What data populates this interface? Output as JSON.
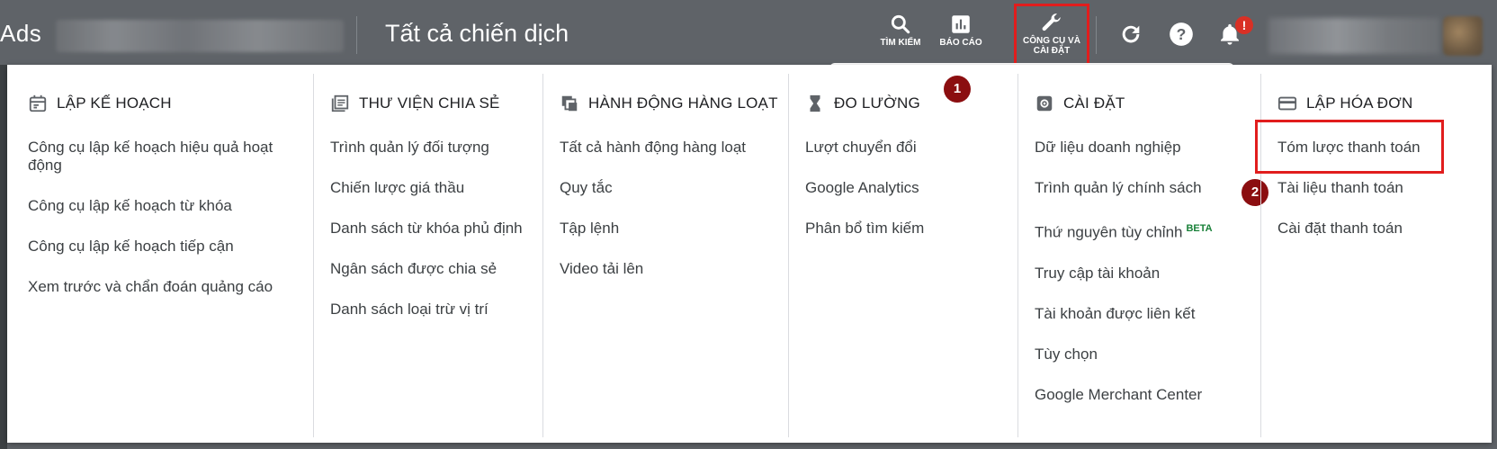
{
  "app": {
    "brand_text": "Ads",
    "page_title": "Tất cả chiến dịch"
  },
  "toolbar": {
    "search_label": "TÌM KIẾM",
    "reports_label": "BÁO CÁO",
    "tools_label": "CÔNG CỤ VÀ\nCÀI ĐẶT",
    "notification_badge": "!"
  },
  "menu": {
    "columns": [
      {
        "heading": "LẬP KẾ HOẠCH",
        "icon": "calendar-icon",
        "items": [
          "Công cụ lập kế hoạch hiệu quả hoạt động",
          "Công cụ lập kế hoạch từ khóa",
          "Công cụ lập kế hoạch tiếp cận",
          "Xem trước và chẩn đoán quảng cáo"
        ]
      },
      {
        "heading": "THƯ VIỆN CHIA SẺ",
        "icon": "library-icon",
        "items": [
          "Trình quản lý đối tượng",
          "Chiến lược giá thầu",
          "Danh sách từ khóa phủ định",
          "Ngân sách được chia sẻ",
          "Danh sách loại trừ vị trí"
        ]
      },
      {
        "heading": "HÀNH ĐỘNG HÀNG LOẠT",
        "icon": "copy-icon",
        "items": [
          "Tất cả hành động hàng loạt",
          "Quy tắc",
          "Tập lệnh",
          "Video tải lên"
        ]
      },
      {
        "heading": "ĐO LƯỜNG",
        "icon": "hourglass-icon",
        "items": [
          "Lượt chuyển đổi",
          "Google Analytics",
          "Phân bổ tìm kiếm"
        ]
      },
      {
        "heading": "CÀI ĐẶT",
        "icon": "settings-icon",
        "items": [
          "Dữ liệu doanh nghiệp",
          "Trình quản lý chính sách",
          "Thứ nguyên tùy chỉnh",
          "Truy cập tài khoản",
          "Tài khoản được liên kết",
          "Tùy chọn",
          "Google Merchant Center"
        ],
        "beta_label": "BETA"
      },
      {
        "heading": "LẬP HÓA ĐƠN",
        "icon": "credit-card-icon",
        "items": [
          "Tóm lược thanh toán",
          "Tài liệu thanh toán",
          "Cài đặt thanh toán"
        ]
      }
    ]
  },
  "callouts": [
    "1",
    "2"
  ],
  "colors": {
    "topbar": "#5f6368",
    "highlight": "#e11d1d",
    "callout": "#8b0e10",
    "beta": "#188038"
  }
}
